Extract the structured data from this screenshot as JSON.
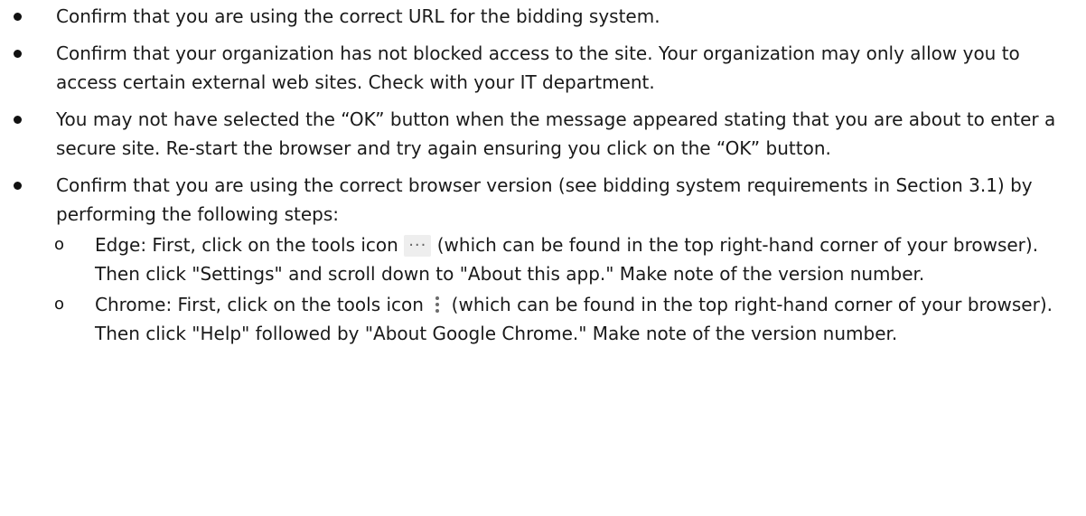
{
  "bullets": [
    {
      "text": "Confirm that you are using the correct URL for the bidding system."
    },
    {
      "text": "Confirm that your organization has not blocked access to the site.  Your organization may only allow you to access certain external web sites.  Check with your IT department."
    },
    {
      "text": "You may not have selected the “OK” button when the message appeared stating that you are about to enter a secure site.  Re-start the browser and try again ensuring you click on the “OK” button."
    },
    {
      "text": "Confirm that you are using the correct browser version (see bidding system requirements in Section 3.1) by performing the following steps:"
    }
  ],
  "sub_items": [
    {
      "marker": "o",
      "before_icon": "Edge: First, click on the tools icon ",
      "icon": "horizontal-ellipsis-icon",
      "icon_glyph": "···",
      "after_icon": " (which can be found in the top right-hand corner of your browser). Then click \"Settings\" and scroll down to \"About this app.\" Make note of the version number."
    },
    {
      "marker": "o",
      "before_icon": "Chrome:  First, click on the tools icon ",
      "icon": "vertical-ellipsis-icon",
      "after_icon": " (which can be found in the top right-hand corner of your browser).  Then click \"Help\" followed by \"About Google Chrome.\"  Make note of the version number."
    }
  ]
}
